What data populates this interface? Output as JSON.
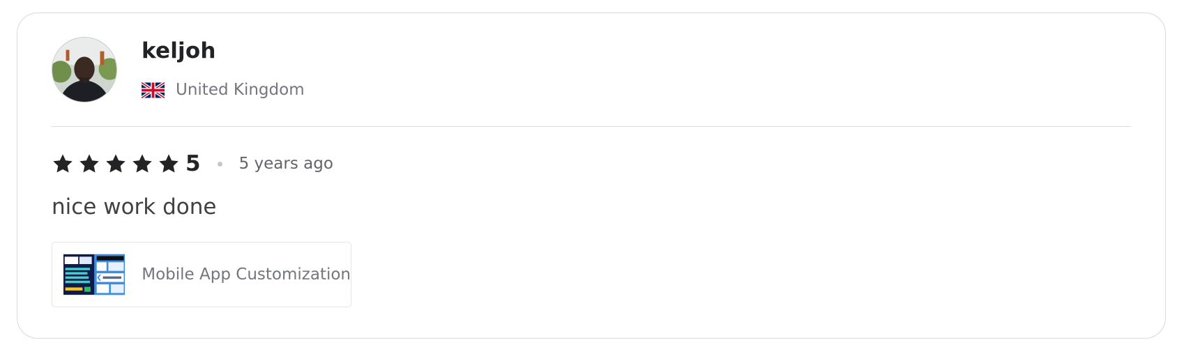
{
  "review": {
    "username": "keljoh",
    "country": "United Kingdom",
    "country_flag": "uk-flag-icon",
    "rating": {
      "stars_filled": 5,
      "stars_total": 5,
      "value_label": "5"
    },
    "time_ago": "5 years ago",
    "text": "nice work done",
    "gig": {
      "title": "Mobile App Customization"
    }
  },
  "colors": {
    "text_primary": "#222325",
    "text_secondary": "#74767e",
    "border": "#dadbdd",
    "star": "#222325"
  }
}
